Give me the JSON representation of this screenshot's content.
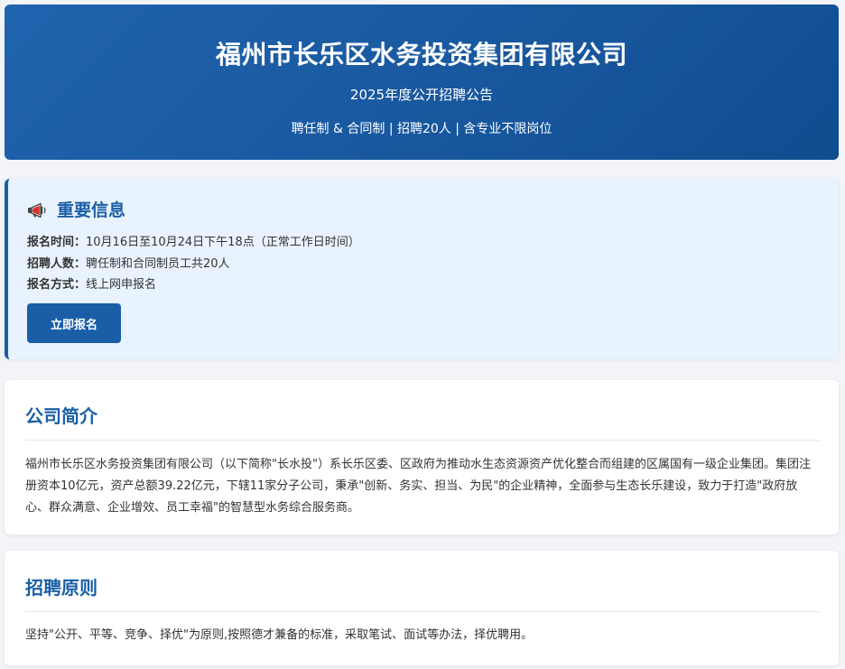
{
  "header": {
    "title": "福州市长乐区水务投资集团有限公司",
    "subtitle": "2025年度公开招聘公告",
    "tagline": "聘任制 & 合同制 | 招聘20人 | 含专业不限岗位"
  },
  "important_info": {
    "icon": "megaphone-icon",
    "heading": "重要信息",
    "items": [
      {
        "label": "报名时间：",
        "value": "10月16日至10月24日下午18点（正常工作日时间）"
      },
      {
        "label": "招聘人数：",
        "value": "聘任制和合同制员工共20人"
      },
      {
        "label": "报名方式：",
        "value": "线上网申报名"
      }
    ],
    "apply_button": "立即报名"
  },
  "company_intro": {
    "title": "公司简介",
    "body": "福州市长乐区水务投资集团有限公司（以下简称\"长水投\"）系长乐区委、区政府为推动水生态资源资产优化整合而组建的区属国有一级企业集团。集团注册资本10亿元，资产总额39.22亿元，下辖11家分子公司，秉承\"创新、务实、担当、为民\"的企业精神，全面参与生态长乐建设，致力于打造\"政府放心、群众满意、企业增效、员工幸福\"的智慧型水务综合服务商。"
  },
  "principles": {
    "title": "招聘原则",
    "body": "坚持\"公开、平等、竞争、择优\"为原则,按照德才兼备的标准，采取笔试、面试等办法，择优聘用。"
  },
  "colors": {
    "brand_blue": "#1a5ea8",
    "header_gradient_start": "#1f64ae",
    "header_gradient_end": "#0f4d8f",
    "info_background": "#e8f3ff",
    "megaphone_red": "#d9302c",
    "page_background": "#f2f4f8"
  }
}
